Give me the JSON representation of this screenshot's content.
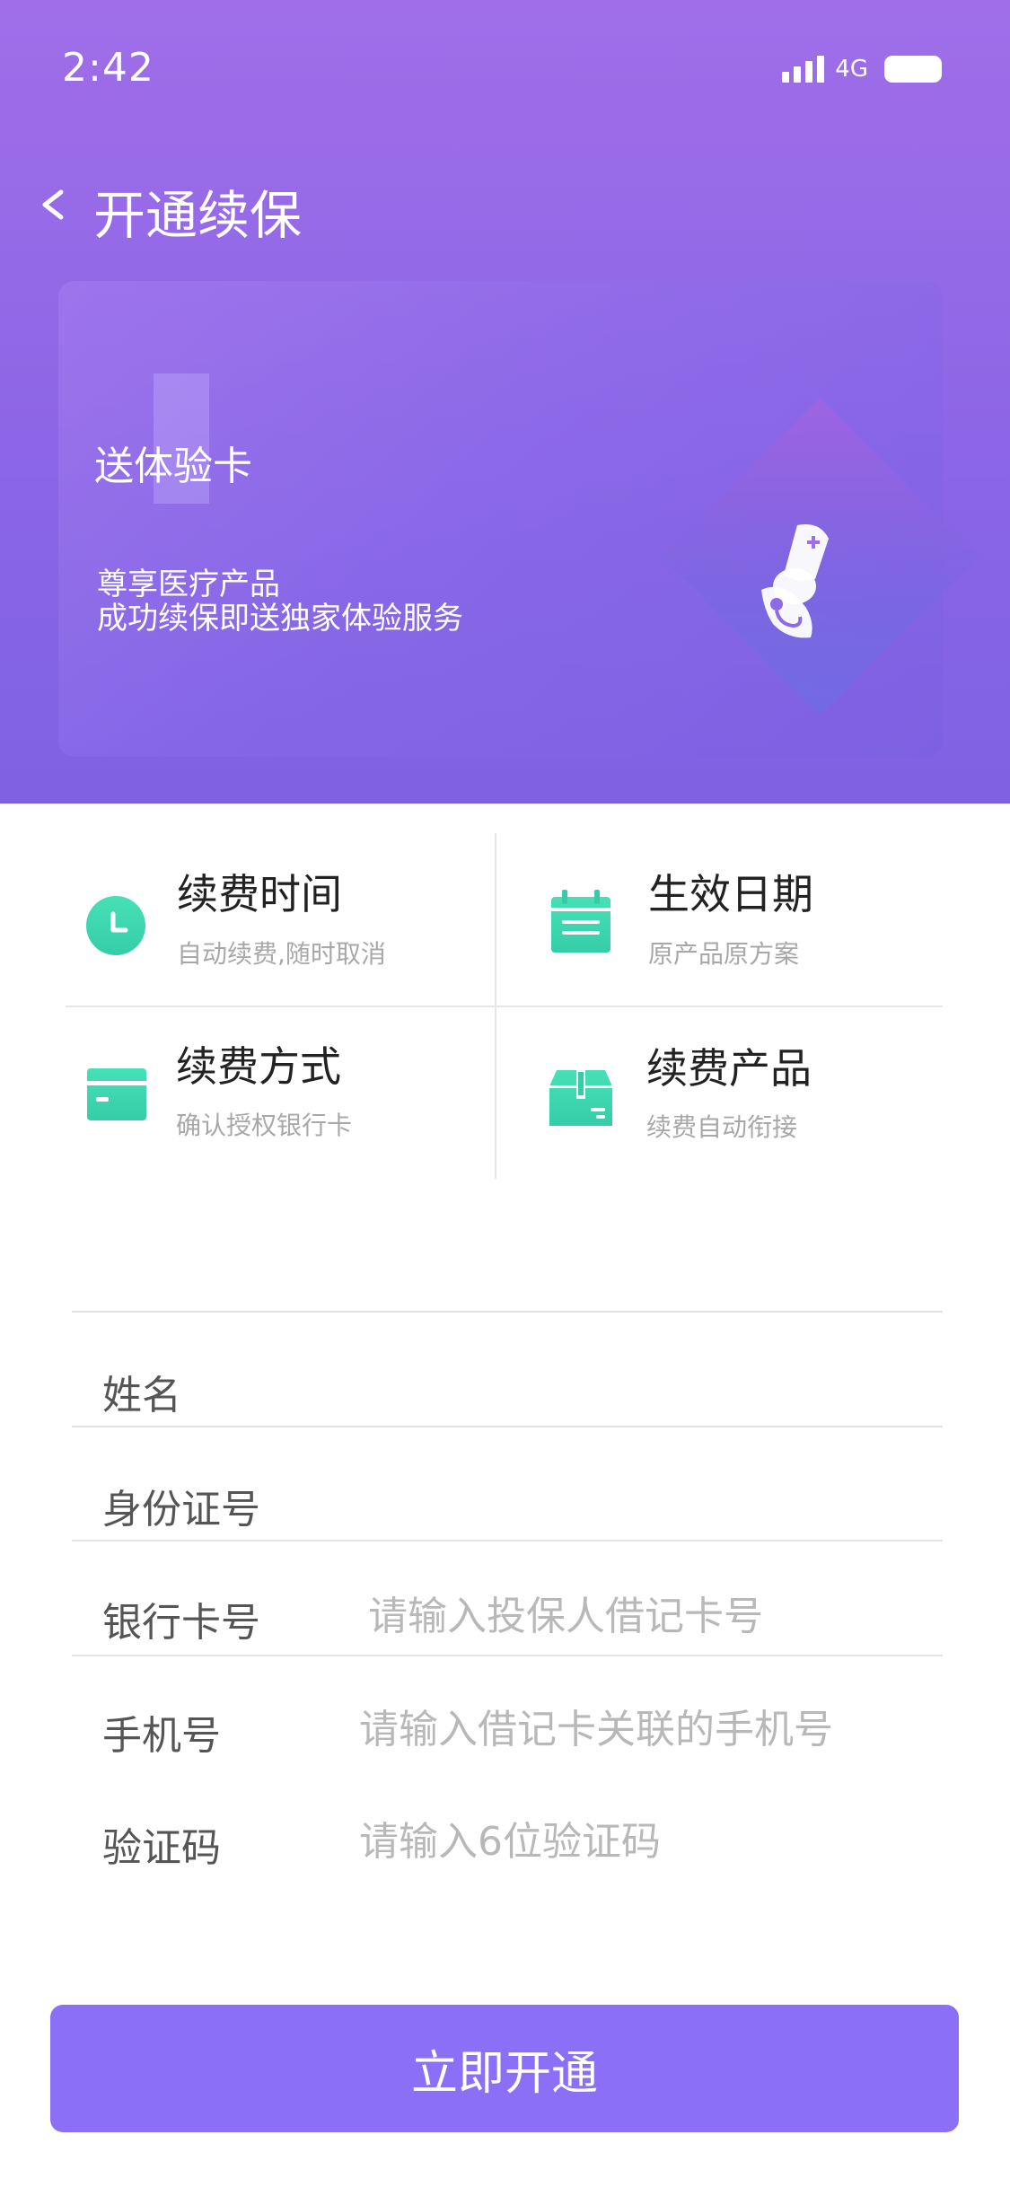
{
  "status_bar": {
    "time": "2:42",
    "network": "4G"
  },
  "nav": {
    "back_label": "<",
    "title": "开通续保"
  },
  "promo_card": {
    "title": "送体验卡",
    "line1": "尊享医疗产品",
    "line2": "成功续保即送独家体验服务",
    "icon": "doctor-icon"
  },
  "features": [
    {
      "title": "续费时间",
      "subtitle": "自动续费,随时取消",
      "icon": "clock-icon"
    },
    {
      "title": "生效日期",
      "subtitle": "原产品原方案",
      "icon": "calendar-icon"
    },
    {
      "title": "续费方式",
      "subtitle": "确认授权银行卡",
      "icon": "card-icon"
    },
    {
      "title": "续费产品",
      "subtitle": "续费自动衔接",
      "icon": "box-icon"
    }
  ],
  "form": {
    "name_label": "姓名",
    "id_label": "身份证号",
    "bank_label": "银行卡号",
    "bank_placeholder": "请输入投保人借记卡号",
    "phone_label": "手机号",
    "phone_placeholder": "请输入借记卡关联的手机号",
    "code_label": "验证码",
    "code_placeholder": "请输入6位验证码"
  },
  "submit_label": "立即开通",
  "colors": {
    "header_top": "#a06ee9",
    "header_bottom": "#7e62e2",
    "icon_teal": "#3dd9b0",
    "button": "#8b70f7"
  }
}
